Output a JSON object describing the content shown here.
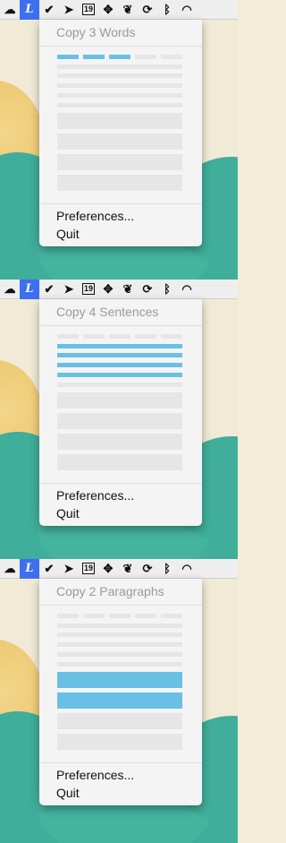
{
  "menubar": {
    "icons": [
      {
        "name": "cloud-icon",
        "glyph": "☁"
      },
      {
        "name": "linguist-icon",
        "glyph": "L",
        "active": true
      },
      {
        "name": "shield-check-icon",
        "glyph": "✔"
      },
      {
        "name": "cursor-arrow-icon",
        "glyph": "➤"
      },
      {
        "name": "calendar-icon",
        "glyph": "19"
      },
      {
        "name": "dropbox-icon",
        "glyph": "✥"
      },
      {
        "name": "evernote-icon",
        "glyph": "❦"
      },
      {
        "name": "sync-icon",
        "glyph": "⟳"
      },
      {
        "name": "bluetooth-icon",
        "glyph": "ᛒ"
      },
      {
        "name": "wifi-icon",
        "glyph": "◠"
      }
    ],
    "accent": "#3d6ff0"
  },
  "menus": [
    {
      "title": "Copy 3 Words",
      "preferences": "Preferences...",
      "quit": "Quit",
      "highlight": "words"
    },
    {
      "title": "Copy 4 Sentences",
      "preferences": "Preferences...",
      "quit": "Quit",
      "highlight": "sentences"
    },
    {
      "title": "Copy 2 Paragraphs",
      "preferences": "Preferences...",
      "quit": "Quit",
      "highlight": "paragraphs"
    }
  ],
  "colors": {
    "highlight": "#6ac0e4",
    "placeholder": "#e6e6e6",
    "wallpaper_teal": "#3fae9a",
    "wallpaper_sun": "#e8bf60"
  }
}
